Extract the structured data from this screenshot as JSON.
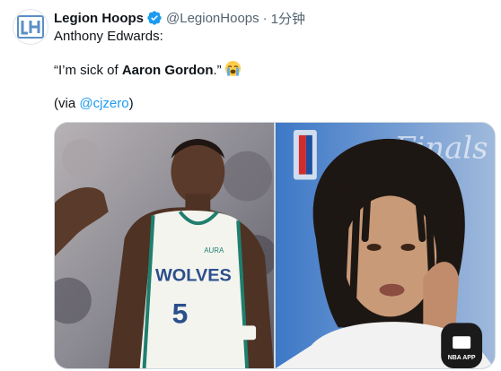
{
  "tweet": {
    "author": {
      "display_name": "Legion Hoops",
      "handle": "@LegionHoops",
      "verified": true,
      "avatar_icon": "legion-hoops-logo"
    },
    "separator": "·",
    "timestamp": "1分钟",
    "text": {
      "line1": "Anthony Edwards:",
      "quote_open": "“I’m sick of ",
      "quote_bold": "Aaron Gordon",
      "quote_close": ".”",
      "quote_emoji": "loudly-crying-face",
      "via_open": "(via ",
      "via_mention": "@cjzero",
      "via_close": ")"
    },
    "media": {
      "left": {
        "jersey_team": "WOLVES",
        "jersey_number": "5",
        "jersey_tag": "AURA"
      },
      "right": {
        "nba_app_text": "NBA APP"
      }
    }
  },
  "colors": {
    "accent": "#1d9bf0",
    "text": "#0f1419",
    "muted": "#536471",
    "border": "#cfd9de"
  }
}
